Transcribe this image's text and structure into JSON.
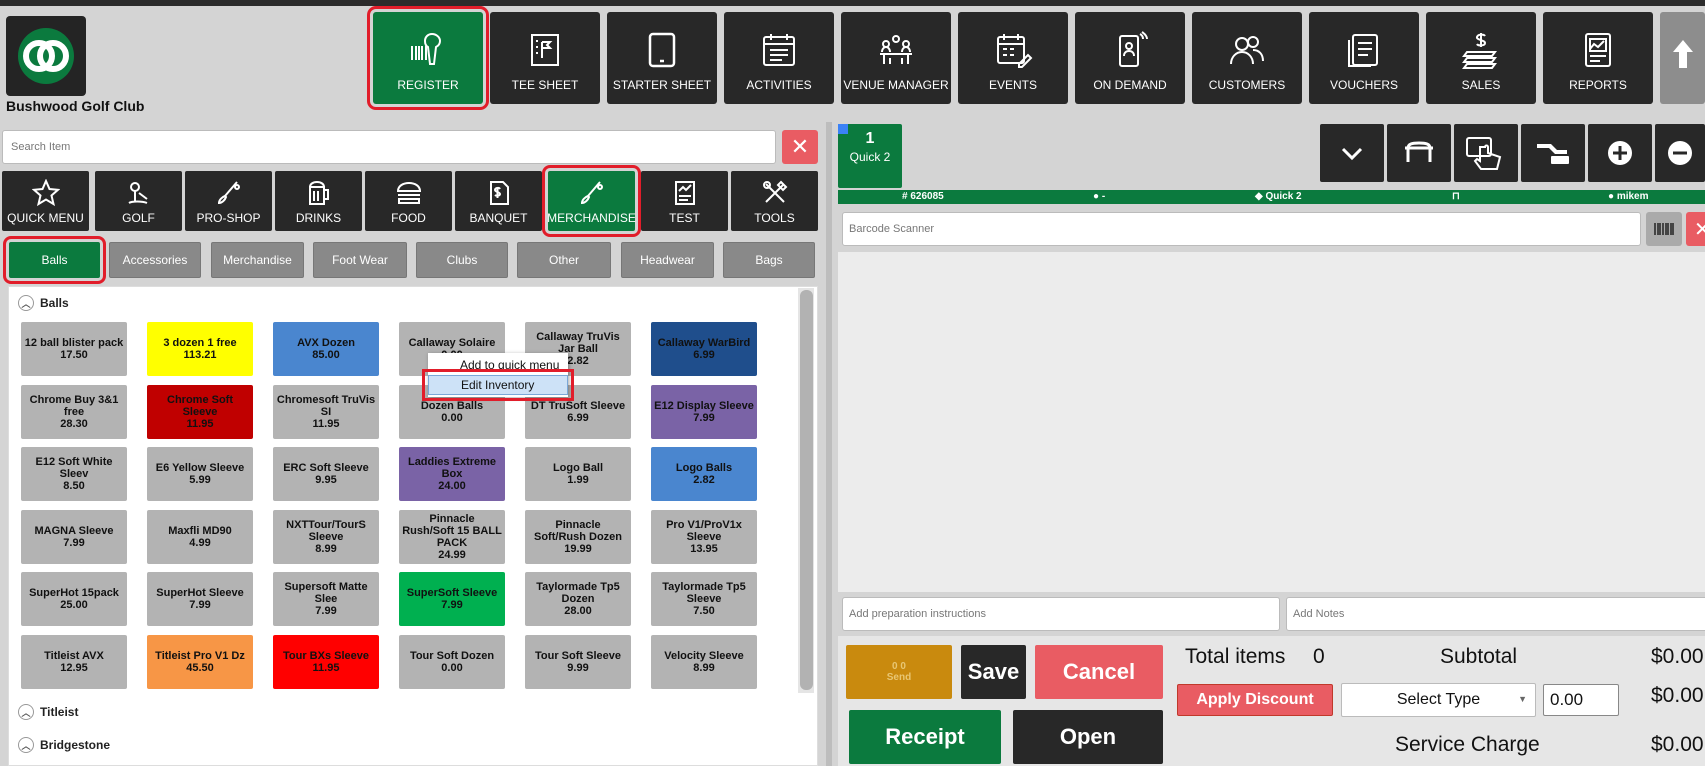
{
  "app": {
    "club_name": "Bushwood Golf Club"
  },
  "nav": [
    {
      "label": "REGISTER",
      "icon": "barcode-scanner-icon"
    },
    {
      "label": "TEE SHEET",
      "icon": "flag-board-icon"
    },
    {
      "label": "STARTER SHEET",
      "icon": "tablet-icon"
    },
    {
      "label": "ACTIVITIES",
      "icon": "calendar-list-icon"
    },
    {
      "label": "VENUE MANAGER",
      "icon": "meeting-table-icon"
    },
    {
      "label": "EVENTS",
      "icon": "calendar-edit-icon"
    },
    {
      "label": "ON DEMAND",
      "icon": "phone-user-icon"
    },
    {
      "label": "CUSTOMERS",
      "icon": "users-icon"
    },
    {
      "label": "VOUCHERS",
      "icon": "vouchers-icon"
    },
    {
      "label": "SALES",
      "icon": "cash-stack-icon"
    },
    {
      "label": "REPORTS",
      "icon": "report-chart-icon"
    }
  ],
  "search": {
    "placeholder": "Search Item",
    "clear": "✕"
  },
  "categories": [
    {
      "label": "QUICK MENU",
      "icon": "star-icon"
    },
    {
      "label": "GOLF",
      "icon": "golf-icon"
    },
    {
      "label": "PRO-SHOP",
      "icon": "golf-club-icon"
    },
    {
      "label": "DRINKS",
      "icon": "beer-mug-icon"
    },
    {
      "label": "FOOD",
      "icon": "burger-icon"
    },
    {
      "label": "BANQUET",
      "icon": "invoice-icon"
    },
    {
      "label": "MERCHANDISE",
      "icon": "golf-club-icon"
    },
    {
      "label": "TEST",
      "icon": "receipt-chart-icon"
    },
    {
      "label": "TOOLS",
      "icon": "tools-icon"
    }
  ],
  "subtabs": [
    "Balls",
    "Accessories",
    "Merchandise",
    "Foot Wear",
    "Clubs",
    "Other",
    "Headwear",
    "Bags"
  ],
  "groups": {
    "balls": "Balls",
    "titleist": "Titleist",
    "bridgestone": "Bridgestone"
  },
  "products": [
    {
      "name": "12 ball blister pack",
      "price": "17.50",
      "color": "#b3b3b3",
      "text": "#111111"
    },
    {
      "name": "3 dozen 1 free",
      "price": "113.21",
      "color": "#ffff00",
      "text": "#111111"
    },
    {
      "name": "AVX Dozen",
      "price": "85.00",
      "color": "#4a86cf",
      "text": "#111111"
    },
    {
      "name": "Callaway Solaire",
      "price": "0.00",
      "color": "#b3b3b3",
      "text": "#111111"
    },
    {
      "name": "Callaway TruVis Jar Ball",
      "price": "2.82",
      "color": "#b3b3b3",
      "text": "#111111"
    },
    {
      "name": "Callaway WarBird",
      "price": "6.99",
      "color": "#1f4e8c",
      "text": "#111111"
    },
    {
      "name": "Chrome Buy 3&1 free",
      "price": "28.30",
      "color": "#b3b3b3",
      "text": "#111111"
    },
    {
      "name": "Chrome Soft Sleeve",
      "price": "11.95",
      "color": "#c00000",
      "text": "#111111"
    },
    {
      "name": "Chromesoft TruVis SI",
      "price": "11.95",
      "color": "#b3b3b3",
      "text": "#111111"
    },
    {
      "name": "Dozen Balls",
      "price": "0.00",
      "color": "#b3b3b3",
      "text": "#111111"
    },
    {
      "name": "DT TruSoft Sleeve",
      "price": "6.99",
      "color": "#b3b3b3",
      "text": "#111111"
    },
    {
      "name": "E12 Display Sleeve",
      "price": "7.99",
      "color": "#7a63a6",
      "text": "#111111"
    },
    {
      "name": "E12 Soft White Sleev",
      "price": "8.50",
      "color": "#b3b3b3",
      "text": "#111111"
    },
    {
      "name": "E6 Yellow Sleeve",
      "price": "5.99",
      "color": "#b3b3b3",
      "text": "#111111"
    },
    {
      "name": "ERC Soft Sleeve",
      "price": "9.95",
      "color": "#b3b3b3",
      "text": "#111111"
    },
    {
      "name": "Laddies Extreme Box",
      "price": "24.00",
      "color": "#7a63a6",
      "text": "#111111"
    },
    {
      "name": "Logo Ball",
      "price": "1.99",
      "color": "#b3b3b3",
      "text": "#111111"
    },
    {
      "name": "Logo Balls",
      "price": "2.82",
      "color": "#4a86cf",
      "text": "#111111"
    },
    {
      "name": "MAGNA Sleeve",
      "price": "7.99",
      "color": "#b3b3b3",
      "text": "#111111"
    },
    {
      "name": "Maxfli MD90",
      "price": "4.99",
      "color": "#b3b3b3",
      "text": "#111111"
    },
    {
      "name": "NXTTour/TourS Sleeve",
      "price": "8.99",
      "color": "#b3b3b3",
      "text": "#111111"
    },
    {
      "name": "Pinnacle Rush/Soft 15 BALL PACK",
      "price": "24.99",
      "color": "#b3b3b3",
      "text": "#111111"
    },
    {
      "name": "Pinnacle Soft/Rush Dozen",
      "price": "19.99",
      "color": "#b3b3b3",
      "text": "#111111"
    },
    {
      "name": "Pro V1/ProV1x Sleeve",
      "price": "13.95",
      "color": "#b3b3b3",
      "text": "#111111"
    },
    {
      "name": "SuperHot 15pack",
      "price": "25.00",
      "color": "#b3b3b3",
      "text": "#111111"
    },
    {
      "name": "SuperHot Sleeve",
      "price": "7.99",
      "color": "#b3b3b3",
      "text": "#111111"
    },
    {
      "name": "Supersoft Matte Slee",
      "price": "7.99",
      "color": "#b3b3b3",
      "text": "#111111"
    },
    {
      "name": "SuperSoft Sleeve",
      "price": "7.99",
      "color": "#00b050",
      "text": "#111111"
    },
    {
      "name": "Taylormade Tp5 Dozen",
      "price": "28.00",
      "color": "#b3b3b3",
      "text": "#111111"
    },
    {
      "name": "Taylormade Tp5 Sleeve",
      "price": "7.50",
      "color": "#b3b3b3",
      "text": "#111111"
    },
    {
      "name": "Titleist AVX",
      "price": "12.95",
      "color": "#b3b3b3",
      "text": "#111111"
    },
    {
      "name": "Titleist Pro V1 Dz",
      "price": "45.50",
      "color": "#f79646",
      "text": "#111111"
    },
    {
      "name": "Tour BXs Sleeve",
      "price": "11.95",
      "color": "#ff0000",
      "text": "#111111"
    },
    {
      "name": "Tour Soft Dozen",
      "price": "0.00",
      "color": "#b3b3b3",
      "text": "#111111"
    },
    {
      "name": "Tour Soft Sleeve",
      "price": "9.99",
      "color": "#b3b3b3",
      "text": "#111111"
    },
    {
      "name": "Velocity Sleeve",
      "price": "8.99",
      "color": "#b3b3b3",
      "text": "#111111"
    }
  ],
  "context_menu": {
    "add": "Add to quick menu",
    "edit": "Edit Inventory"
  },
  "order": {
    "tab_number": "1",
    "tab_name": "Quick 2",
    "info": {
      "ticket": "626085",
      "customer": "-",
      "tag": "Quick 2",
      "user": "mikem"
    },
    "barcode_placeholder": "Barcode Scanner",
    "barcode_clear": "✕",
    "prep_placeholder": "Add preparation instructions",
    "notes_placeholder": "Add Notes",
    "send": {
      "counts": "0  0",
      "label": "Send"
    },
    "buttons": {
      "save": "Save",
      "cancel": "Cancel",
      "receipt": "Receipt",
      "open": "Open",
      "apply_discount": "Apply Discount"
    },
    "total_items_label": "Total items",
    "total_items_value": "0",
    "subtotal_label": "Subtotal",
    "subtotal_value": "$0.00",
    "discount_type": "Select Type",
    "discount_value": "0.00",
    "discount_total": "$0.00",
    "service_charge_label": "Service Charge",
    "service_charge_value": "$0.00"
  },
  "colors": {
    "accent_green": "#0b7a3e",
    "dark_tile": "#282828",
    "highlight_red": "#e11d2a",
    "cancel_red": "#e95c63",
    "send_orange": "#c98a0e"
  }
}
